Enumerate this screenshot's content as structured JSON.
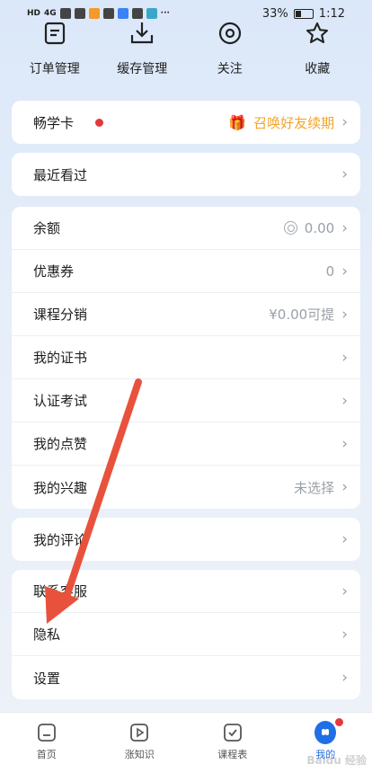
{
  "status_bar": {
    "left_text": "HD",
    "network": "4G",
    "battery": "33%",
    "battery_level": 0.33,
    "time": "1:12"
  },
  "quick_nav": [
    {
      "label": "订单管理",
      "icon": "order-list-icon"
    },
    {
      "label": "缓存管理",
      "icon": "download-icon"
    },
    {
      "label": "关注",
      "icon": "eye-icon"
    },
    {
      "label": "收藏",
      "icon": "star-icon"
    }
  ],
  "membership": {
    "label": "畅学卡",
    "promo": "召唤好友续期",
    "promo_icon": "gift-icon"
  },
  "recent": {
    "label": "最近看过"
  },
  "wallet": {
    "balance_label": "余额",
    "balance_value": "0.00",
    "coupon_label": "优惠券",
    "coupon_value": "0",
    "distribution_label": "课程分销",
    "distribution_value": "¥0.00可提",
    "certificate_label": "我的证书",
    "exam_label": "认证考试",
    "likes_label": "我的点赞",
    "interests_label": "我的兴趣",
    "interests_value": "未选择"
  },
  "comments": {
    "label": "我的评论"
  },
  "support": {
    "service_label": "联系客服",
    "privacy_label": "隐私",
    "settings_label": "设置"
  },
  "tabs": [
    {
      "label": "首页",
      "icon": "home-icon"
    },
    {
      "label": "涨知识",
      "icon": "play-icon"
    },
    {
      "label": "课程表",
      "icon": "schedule-icon"
    },
    {
      "label": "我的",
      "icon": "profile-icon"
    }
  ],
  "colors": {
    "accent": "#1f6fe5",
    "promo": "#f2a52b",
    "badge": "#e3393c",
    "arrow": "#e8523c"
  },
  "watermark": "Baidu 经验"
}
